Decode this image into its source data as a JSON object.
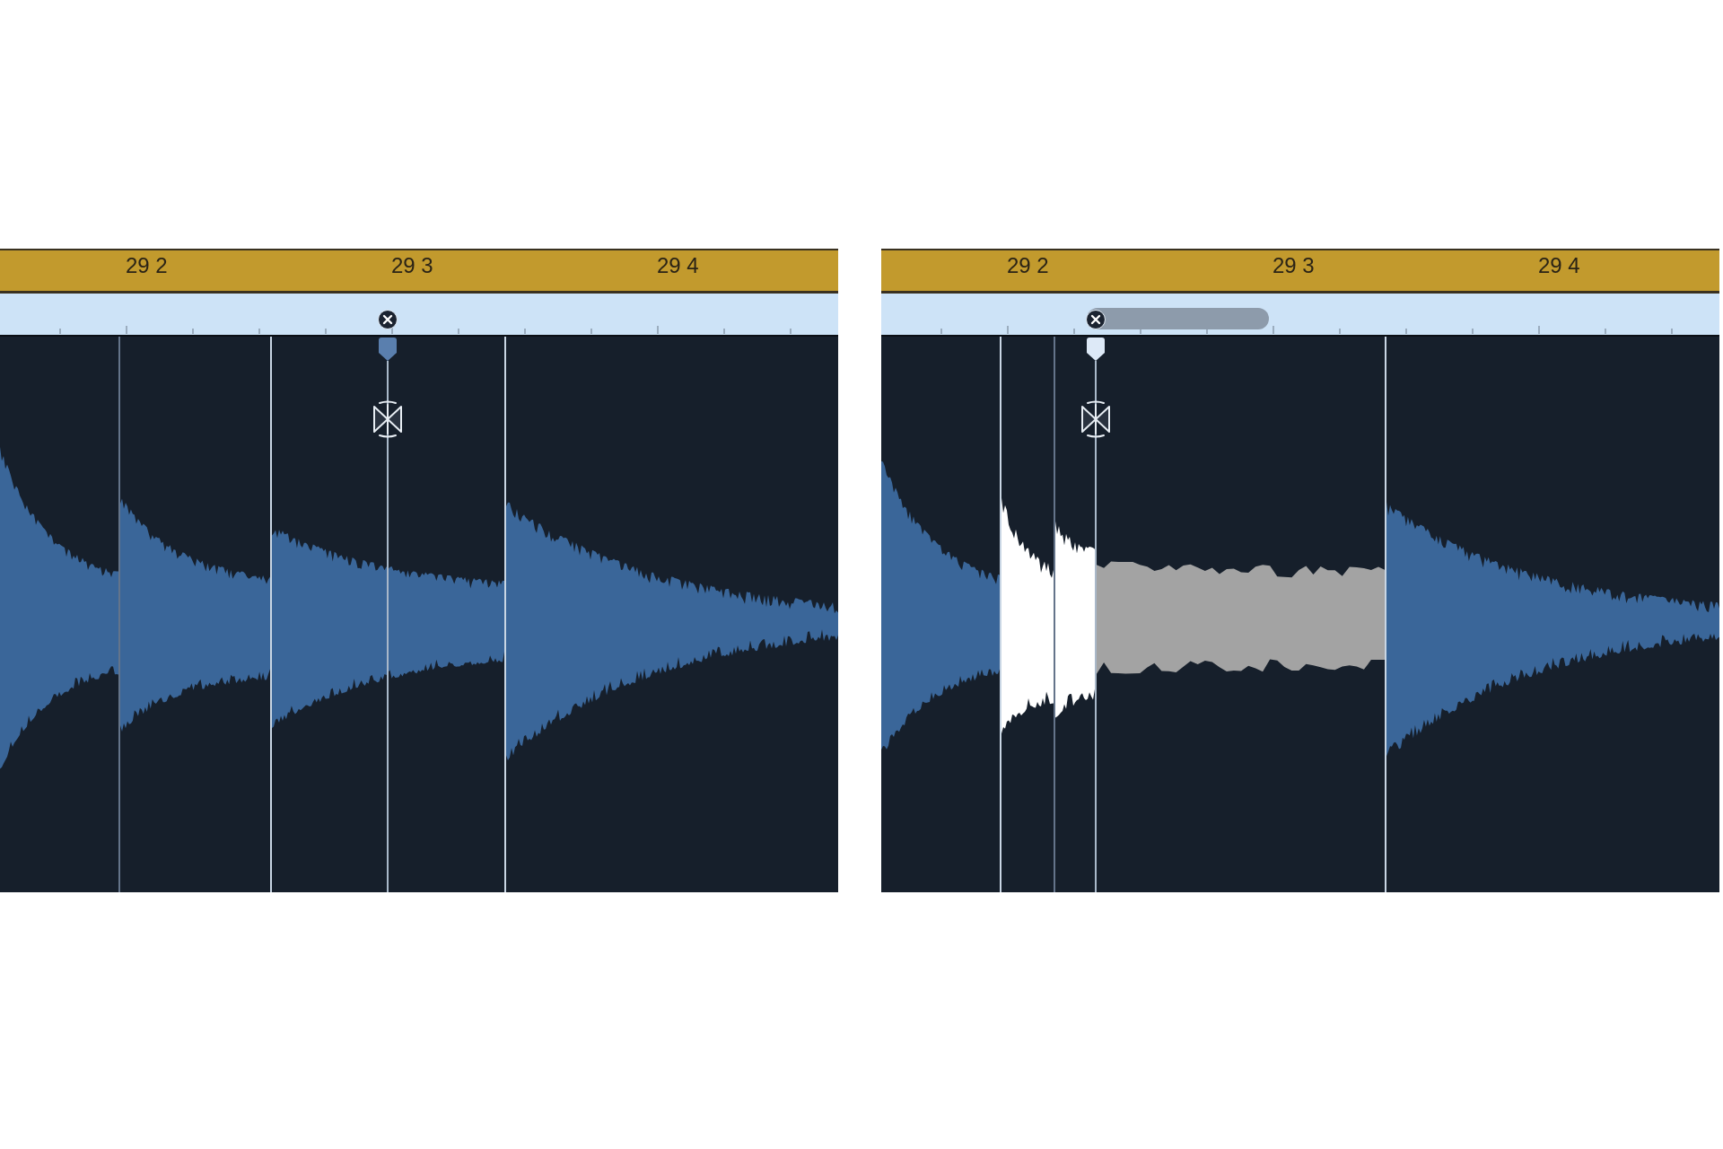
{
  "panels": [
    {
      "kind": "marker",
      "ruler_labels": [
        "29 2",
        "29 3",
        "29 4"
      ],
      "flex_marker": {
        "selected": false
      }
    },
    {
      "kind": "drag",
      "ruler_labels": [
        "29 2",
        "29 3",
        "29 4"
      ],
      "flex_marker": {
        "selected": true
      }
    }
  ]
}
